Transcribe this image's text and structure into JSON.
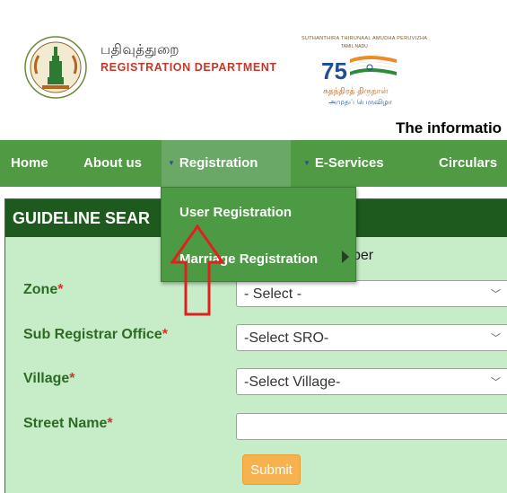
{
  "header": {
    "dept_tamil": "பதிவுத்துறை",
    "dept_name": "REGISTRATION DEPARTMENT",
    "azadi_line1": "SUTHANTHIRA THIRUNAAL AMUDHA PERUVIZHA",
    "azadi_line2": "TAMIL NADU",
    "azadi_tamil1": "சுதந்திரத் திருநாள்",
    "azadi_tamil2": "அமுதப் பெருவிழா",
    "azadi_number": "75",
    "info_text": "The informatio"
  },
  "nav": {
    "items": [
      {
        "label": "Home"
      },
      {
        "label": "About us"
      },
      {
        "label": "Registration"
      },
      {
        "label": "E-Services"
      },
      {
        "label": "Circulars"
      }
    ]
  },
  "dropdown": {
    "items": [
      {
        "label": "User Registration"
      },
      {
        "label": "Marriage Registration"
      }
    ]
  },
  "panel": {
    "title": "GUIDELINE SEAR",
    "behind_text": "ber",
    "required_mark": "*",
    "fields": {
      "zone": {
        "label": "Zone",
        "value": "- Select -"
      },
      "sro": {
        "label": "Sub Registrar Office",
        "value": "-Select SRO-"
      },
      "village": {
        "label": "Village",
        "value": "-Select Village-"
      },
      "street": {
        "label": "Street Name",
        "value": ""
      }
    },
    "submit_label": "Submit"
  },
  "colors": {
    "nav_bg": "#4f9a43",
    "nav_active_bg": "#6aa866",
    "panel_bg": "#c6ecc8",
    "panel_header_bg": "#1e5a1e",
    "label_color": "#2d6b24",
    "required_color": "#d0342c",
    "submit_bg": "#f5b24f",
    "annotation_arrow": "#e02020"
  }
}
